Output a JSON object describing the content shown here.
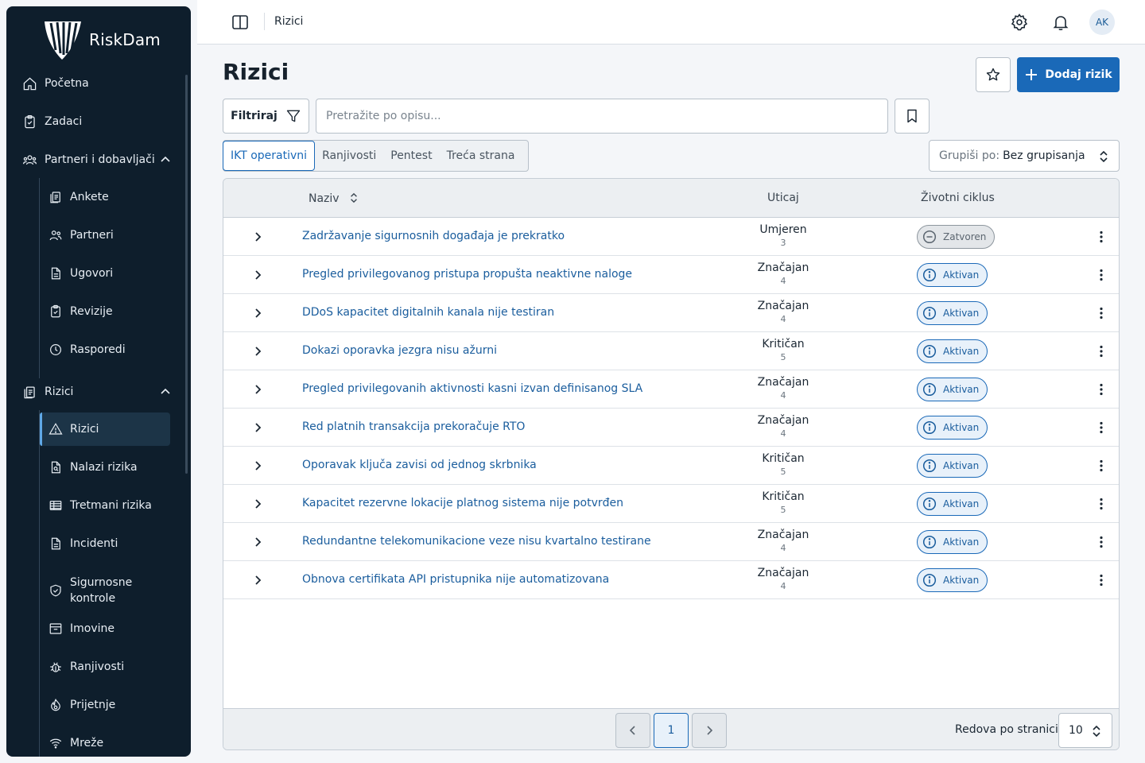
{
  "app": {
    "name": "RiskDam"
  },
  "sidebar": {
    "items": [
      {
        "label": "Početna",
        "icon": "home-icon"
      },
      {
        "label": "Zadaci",
        "icon": "clipboard-check-icon"
      },
      {
        "label": "Partneri i dobavljači",
        "icon": "users-group-icon",
        "expanded": true
      },
      {
        "label": "Rizici",
        "icon": "clipboard-list-icon",
        "expanded": true
      }
    ],
    "partner_sub": [
      {
        "label": "Ankete",
        "icon": "survey-icon"
      },
      {
        "label": "Partneri",
        "icon": "users-icon"
      },
      {
        "label": "Ugovori",
        "icon": "document-icon"
      },
      {
        "label": "Revizije",
        "icon": "clipboard-check-icon"
      },
      {
        "label": "Rasporedi",
        "icon": "clock-icon"
      }
    ],
    "risk_sub": [
      {
        "label": "Rizici",
        "icon": "warning-icon",
        "active": true
      },
      {
        "label": "Nalazi rizika",
        "icon": "file-search-icon"
      },
      {
        "label": "Tretmani rizika",
        "icon": "table-icon"
      },
      {
        "label": "Incidenti",
        "icon": "document-icon"
      },
      {
        "label": "Sigurnosne kontrole",
        "icon": "shield-check-icon"
      },
      {
        "label": "Imovine",
        "icon": "archive-icon"
      },
      {
        "label": "Ranjivosti",
        "icon": "bug-icon"
      },
      {
        "label": "Prijetnje",
        "icon": "fire-icon"
      },
      {
        "label": "Mreže",
        "icon": "wifi-icon"
      }
    ]
  },
  "topbar": {
    "title": "Rizici",
    "avatar": "AK"
  },
  "header": {
    "title": "Rizici",
    "add_label": "Dodaj rizik"
  },
  "toolbar": {
    "filter_label": "Filtriraj",
    "search_placeholder": "Pretražite po opisu...",
    "group_label": "Grupiši po:",
    "group_value": "Bez grupisanja"
  },
  "tabs": [
    "IKT operativni",
    "Ranjivosti",
    "Pentest",
    "Treća strana"
  ],
  "table": {
    "columns": {
      "name": "Naziv",
      "impact": "Uticaj",
      "lifecycle": "Životni ciklus"
    },
    "rows": [
      {
        "name": "Zadržavanje sigurnosnih događaja je prekratko",
        "impact": "Umjeren",
        "score": "3",
        "status": "Zatvoren",
        "status_type": "closed"
      },
      {
        "name": "Pregled privilegovanog pristupa propušta neaktivne naloge",
        "impact": "Značajan",
        "score": "4",
        "status": "Aktivan",
        "status_type": "active"
      },
      {
        "name": "DDoS kapacitet digitalnih kanala nije testiran",
        "impact": "Značajan",
        "score": "4",
        "status": "Aktivan",
        "status_type": "active"
      },
      {
        "name": "Dokazi oporavka jezgra nisu ažurni",
        "impact": "Kritičan",
        "score": "5",
        "status": "Aktivan",
        "status_type": "active"
      },
      {
        "name": "Pregled privilegovanih aktivnosti kasni izvan definisanog SLA",
        "impact": "Značajan",
        "score": "4",
        "status": "Aktivan",
        "status_type": "active"
      },
      {
        "name": "Red platnih transakcija prekoračuje RTO",
        "impact": "Značajan",
        "score": "4",
        "status": "Aktivan",
        "status_type": "active"
      },
      {
        "name": "Oporavak ključa zavisi od jednog skrbnika",
        "impact": "Kritičan",
        "score": "5",
        "status": "Aktivan",
        "status_type": "active"
      },
      {
        "name": "Kapacitet rezervne lokacije platnog sistema nije potvrđen",
        "impact": "Kritičan",
        "score": "5",
        "status": "Aktivan",
        "status_type": "active"
      },
      {
        "name": "Redundantne telekomunikacione veze nisu kvartalno testirane",
        "impact": "Značajan",
        "score": "4",
        "status": "Aktivan",
        "status_type": "active"
      },
      {
        "name": "Obnova certifikata API pristupnika nije automatizovana",
        "impact": "Značajan",
        "score": "4",
        "status": "Aktivan",
        "status_type": "active"
      }
    ]
  },
  "pagination": {
    "current_page": "1",
    "rows_label": "Redova po stranici",
    "rows_value": "10"
  },
  "colors": {
    "primary": "#1a69b8",
    "sidebar_bg": "#0e1e2c",
    "link": "#1a5d9d"
  }
}
